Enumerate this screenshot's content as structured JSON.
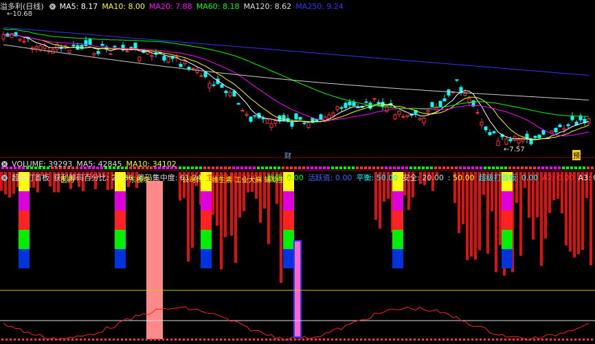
{
  "main_panel": {
    "title": "溢多利(日线)",
    "ma": [
      {
        "label": "MA5: 8.17",
        "color": "#ffffff"
      },
      {
        "label": "MA10: 8.00",
        "color": "#ffff00"
      },
      {
        "label": "MA20: 7.88",
        "color": "#ff00ff"
      },
      {
        "label": "MA60: 8.18",
        "color": "#00ff00"
      },
      {
        "label": "MA120: 8.62",
        "color": "#dddddd"
      },
      {
        "label": "MA250: 9.24",
        "color": "#3333ff"
      }
    ],
    "high_label": "10.68",
    "low_label": "7.57",
    "marker_cai": "财",
    "marker_yu": "预",
    "colors": {
      "up": "#ff3333",
      "down": "#00ffff",
      "bg": "#000000"
    }
  },
  "volume_panel": {
    "labels": [
      {
        "label": "VOLUME: 39293",
        "color": "#dddddd"
      },
      {
        "label": "MA5: 42845",
        "color": "#dddddd"
      },
      {
        "label": "MA10: 34102",
        "color": "#ffff00"
      }
    ]
  },
  "indicator_panel": {
    "labels": [
      {
        "label": "超级打首板",
        "color": "#dddddd"
      },
      {
        "label": "获利筹码百分比: 21.86",
        "color": "#dddddd"
      },
      {
        "label": "筹码集中度: 61.24",
        "color": "#dddddd"
      },
      {
        "label": "主力控盘: 27.02",
        "color": "#ff3333"
      },
      {
        "label": "数量: 0.00",
        "color": "#00ff00"
      },
      {
        "label": "活跃资: 0.00",
        "color": "#3366ff"
      },
      {
        "label": "平衡: 50.00",
        "color": "#00ffff"
      },
      {
        "label": "安全: 20.00",
        "color": "#dddddd"
      },
      {
        "label": ": 50.00",
        "color": "#ffff00"
      },
      {
        "label": "超级打首板: 0.00",
        "color": "#00ffff"
      },
      {
        "label": "A2: 0.00",
        "color": "#ff3333"
      },
      {
        "label": "A3: 0.00",
        "color": "#ffffff"
      }
    ],
    "annotations": [
      {
        "text": "医药",
        "color": "#ffff00"
      },
      {
        "text": "广东板块",
        "color": "#ffff00"
      },
      {
        "text": "公司转债 维生素 工业大麻 辅助生殖",
        "color": "#ffff00"
      }
    ]
  }
}
